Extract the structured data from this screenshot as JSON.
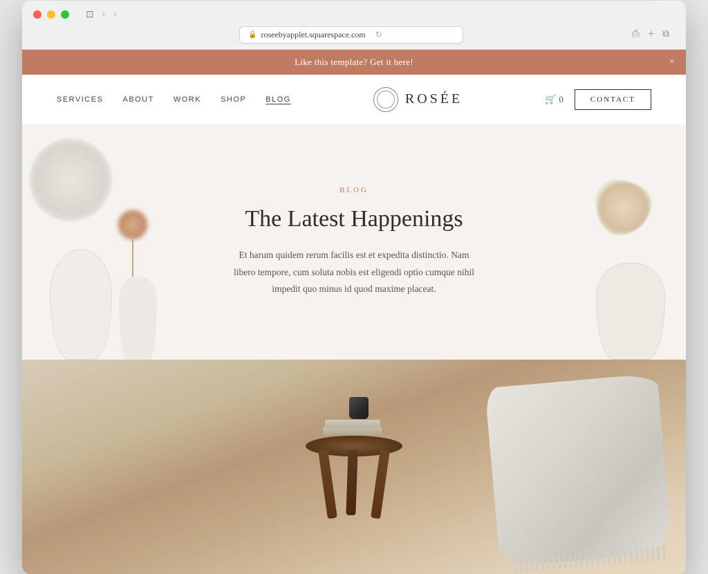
{
  "browser": {
    "url": "roseebyapplet.squarespace.com",
    "reload_icon": "↻",
    "back_icon": "‹",
    "forward_icon": "›",
    "window_icon": "⊡"
  },
  "banner": {
    "text": "Like this template? Get it here!",
    "close_icon": "×"
  },
  "nav": {
    "logo_text": "ROSÉE",
    "items": [
      {
        "label": "SERVICES",
        "active": false
      },
      {
        "label": "ABOUT",
        "active": false
      },
      {
        "label": "WORK",
        "active": false
      },
      {
        "label": "SHOP",
        "active": false
      },
      {
        "label": "BLOG",
        "active": true
      }
    ],
    "cart_count": "0",
    "cart_icon": "🛒",
    "contact_label": "CONTACT"
  },
  "hero": {
    "label": "BLOG",
    "title": "The Latest Happenings",
    "description": "Et harum quidem rerum facilis est et expedita distinctio. Nam libero tempore, cum soluta nobis est eligendi optio cumque nihil impedit quo minus id quod maxime placeat."
  },
  "colors": {
    "banner_bg": "#c17b63",
    "accent": "#c17b63",
    "nav_border": "#333",
    "text_dark": "#2c2c2c",
    "text_medium": "#555",
    "background": "#f5f2ef"
  }
}
